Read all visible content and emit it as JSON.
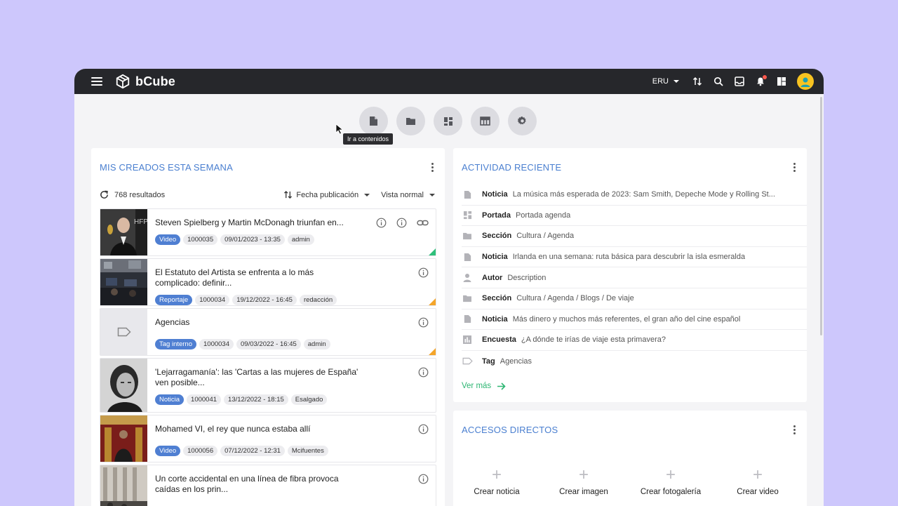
{
  "app": {
    "name": "bCube"
  },
  "topbar": {
    "language": "ERU"
  },
  "quick_actions": {
    "tooltip": "Ir a contenidos",
    "buttons": [
      "document-icon",
      "folder-icon",
      "dashboard-icon",
      "table-icon",
      "settings-icon"
    ]
  },
  "created": {
    "title": "MIS CREADOS ESTA SEMANA",
    "count": "768 resultados",
    "sort_label": "Fecha publicación",
    "view_label": "Vista normal",
    "items": [
      {
        "title": "Steven Spielberg y Martin McDonagh triunfan en...",
        "type": "Video",
        "id": "1000035",
        "date": "09/01/2023 - 13:35",
        "author": "admin",
        "status_color": "#2fc07b"
      },
      {
        "title": "El Estatuto del Artista se enfrenta a lo más complicado: definir...",
        "type": "Reportaje",
        "id": "1000034",
        "date": "19/12/2022 - 16:45",
        "author": "redacción",
        "status_color": "#f4a52a"
      },
      {
        "title": "Agencias",
        "type": "Tag interno",
        "id": "1000034",
        "date": "09/03/2022 - 16:45",
        "author": "admin",
        "status_color": "#f4a52a"
      },
      {
        "title": "'Lejarragamanía': las 'Cartas a las mujeres de España' ven posible...",
        "type": "Noticia",
        "id": "1000041",
        "date": "13/12/2022 - 18:15",
        "author": "Esalgado"
      },
      {
        "title": "Mohamed VI, el rey que nunca estaba allí",
        "type": "Video",
        "id": "1000056",
        "date": "07/12/2022 - 12:31",
        "author": "Mcifuentes"
      },
      {
        "title": "Un corte accidental en una línea de fibra provoca caídas en los prin...",
        "type": "",
        "id": "",
        "date": "",
        "author": ""
      }
    ]
  },
  "activity": {
    "title": "ACTIVIDAD RECIENTE",
    "items": [
      {
        "icon": "document-icon",
        "type": "Noticia",
        "desc": "La música más esperada de 2023: Sam Smith, Depeche Mode y Rolling St..."
      },
      {
        "icon": "dashboard-icon",
        "type": "Portada",
        "desc": "Portada agenda"
      },
      {
        "icon": "folder-icon",
        "type": "Sección",
        "desc": "Cultura / Agenda"
      },
      {
        "icon": "document-icon",
        "type": "Noticia",
        "desc": "Irlanda en una semana: ruta básica para descubrir la isla esmeralda"
      },
      {
        "icon": "person-icon",
        "type": "Autor",
        "desc": "Description"
      },
      {
        "icon": "folder-icon",
        "type": "Sección",
        "desc": "Cultura / Agenda / Blogs / De viaje"
      },
      {
        "icon": "document-icon",
        "type": "Noticia",
        "desc": "Más dinero y muchos más referentes, el gran año del cine español"
      },
      {
        "icon": "poll-icon",
        "type": "Encuesta",
        "desc": "¿A dónde te irías de viaje esta primavera?"
      },
      {
        "icon": "tag-icon",
        "type": "Tag",
        "desc": "Agencias"
      }
    ],
    "more": "Ver más"
  },
  "shortcuts": {
    "title": "ACCESOS DIRECTOS",
    "items": [
      "Crear noticia",
      "Crear imagen",
      "Crear fotogalería",
      "Crear video"
    ]
  }
}
